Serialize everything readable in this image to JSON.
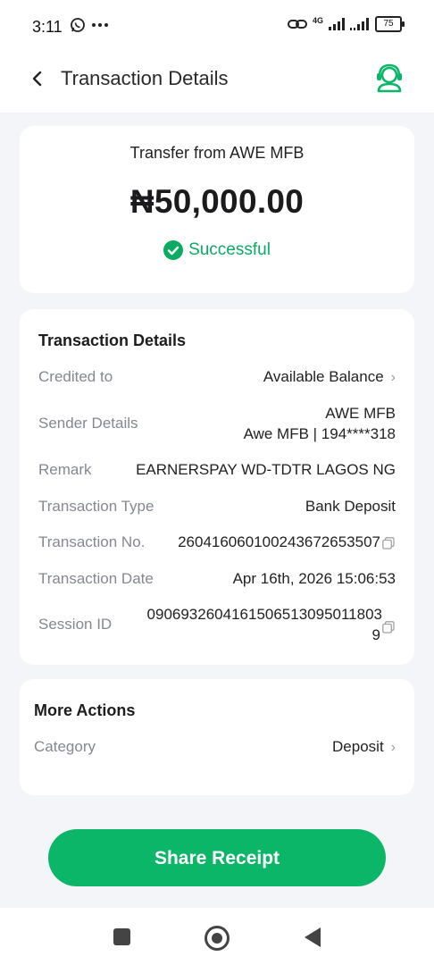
{
  "status_bar": {
    "time": "3:11",
    "network": "4G",
    "battery": "75"
  },
  "header": {
    "title": "Transaction Details"
  },
  "summary": {
    "subtitle": "Transfer from AWE MFB",
    "amount": "₦50,000.00",
    "status": "Successful",
    "status_color": "#0bab62"
  },
  "details": {
    "title": "Transaction Details",
    "credited_to_label": "Credited to",
    "credited_to_value": "Available Balance",
    "sender_label": "Sender Details",
    "sender_line1": "AWE MFB",
    "sender_line2": "Awe MFB | 194****318",
    "remark_label": "Remark",
    "remark_value": "EARNERSPAY WD-TDTR LAGOS NG",
    "type_label": "Transaction Type",
    "type_value": "Bank Deposit",
    "no_label": "Transaction No.",
    "no_value": "260416060100243672653507",
    "date_label": "Transaction Date",
    "date_value": "Apr 16th, 2026 15:06:53",
    "session_label": "Session ID",
    "session_line1": "0906932604161506513095011803",
    "session_line2": "9"
  },
  "more_actions": {
    "title": "More Actions",
    "category_label": "Category",
    "category_value": "Deposit"
  },
  "share_button": "Share Receipt",
  "colors": {
    "accent": "#0cb668",
    "background": "#f4f5f8"
  }
}
